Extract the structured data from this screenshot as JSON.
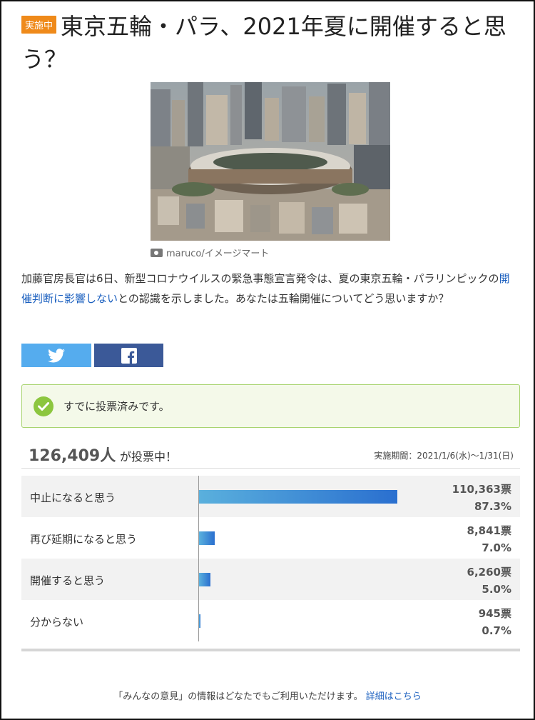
{
  "header": {
    "badge": "実施中",
    "title": "東京五輪・パラ、2021年夏に開催すると思う？"
  },
  "photo": {
    "credit": "maruco/イメージマート"
  },
  "description": {
    "before_link": "加藤官房長官は6日、新型コロナウイルスの緊急事態宣言発令は、夏の東京五輪・パラリンピックの",
    "link": "開催判断に影響しない",
    "after_link": "との認識を示しました。あなたは五輪開催についてどう思いますか？"
  },
  "share": {
    "twitter_icon": "twitter-icon",
    "facebook_icon": "facebook-icon"
  },
  "notice": {
    "text": "すでに投票済みです。"
  },
  "stats": {
    "count": "126,409人",
    "suffix": "が投票中！",
    "period": "実施期間：2021/1/6(水)〜1/31(日)"
  },
  "results": [
    {
      "label": "中止になると思う",
      "votes": "110,363票",
      "pct": "87.3%",
      "value": 87.3
    },
    {
      "label": "再び延期になると思う",
      "votes": "8,841票",
      "pct": "7.0%",
      "value": 7.0
    },
    {
      "label": "開催すると思う",
      "votes": "6,260票",
      "pct": "5.0%",
      "value": 5.0
    },
    {
      "label": "分からない",
      "votes": "945票",
      "pct": "0.7%",
      "value": 0.7
    }
  ],
  "footer": {
    "text": "「みんなの意見」の情報はどなたでもご利用いただけます。",
    "link": "詳細はこちら"
  },
  "colors": {
    "badge": "#ef8a1a",
    "link": "#1a5fbf",
    "twitter": "#55acee",
    "facebook": "#3b5998",
    "check": "#8cc63f"
  }
}
